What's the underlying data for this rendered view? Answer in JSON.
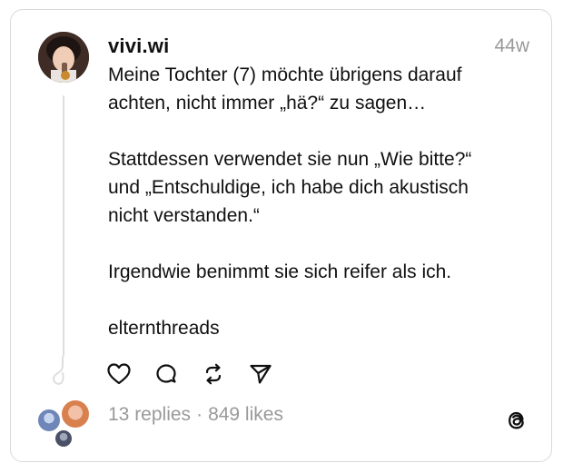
{
  "post": {
    "username": "vivi.wi",
    "timestamp": "44w",
    "paragraphs": [
      [
        "Meine Tochter (7) möchte übrigens darauf",
        "achten, nicht immer „hä?“ zu sagen…"
      ],
      [
        "Stattdessen verwendet sie nun „Wie bitte?“",
        "und „Entschuldige, ich habe dich akustisch",
        "nicht verstanden.“"
      ],
      [
        "Irgendwie benimmt sie sich reifer als ich."
      ],
      [
        "elternthreads"
      ]
    ]
  },
  "stats": {
    "replies": "13 replies",
    "separator": "·",
    "likes": "849 likes"
  },
  "actions": {
    "like_icon": "heart-icon",
    "comment_icon": "comment-icon",
    "repost_icon": "repost-icon",
    "share_icon": "send-icon"
  },
  "brand_icon": "threads-logo-icon",
  "colors": {
    "text": "#101010",
    "muted": "#999999",
    "border": "#d9d9d9"
  }
}
